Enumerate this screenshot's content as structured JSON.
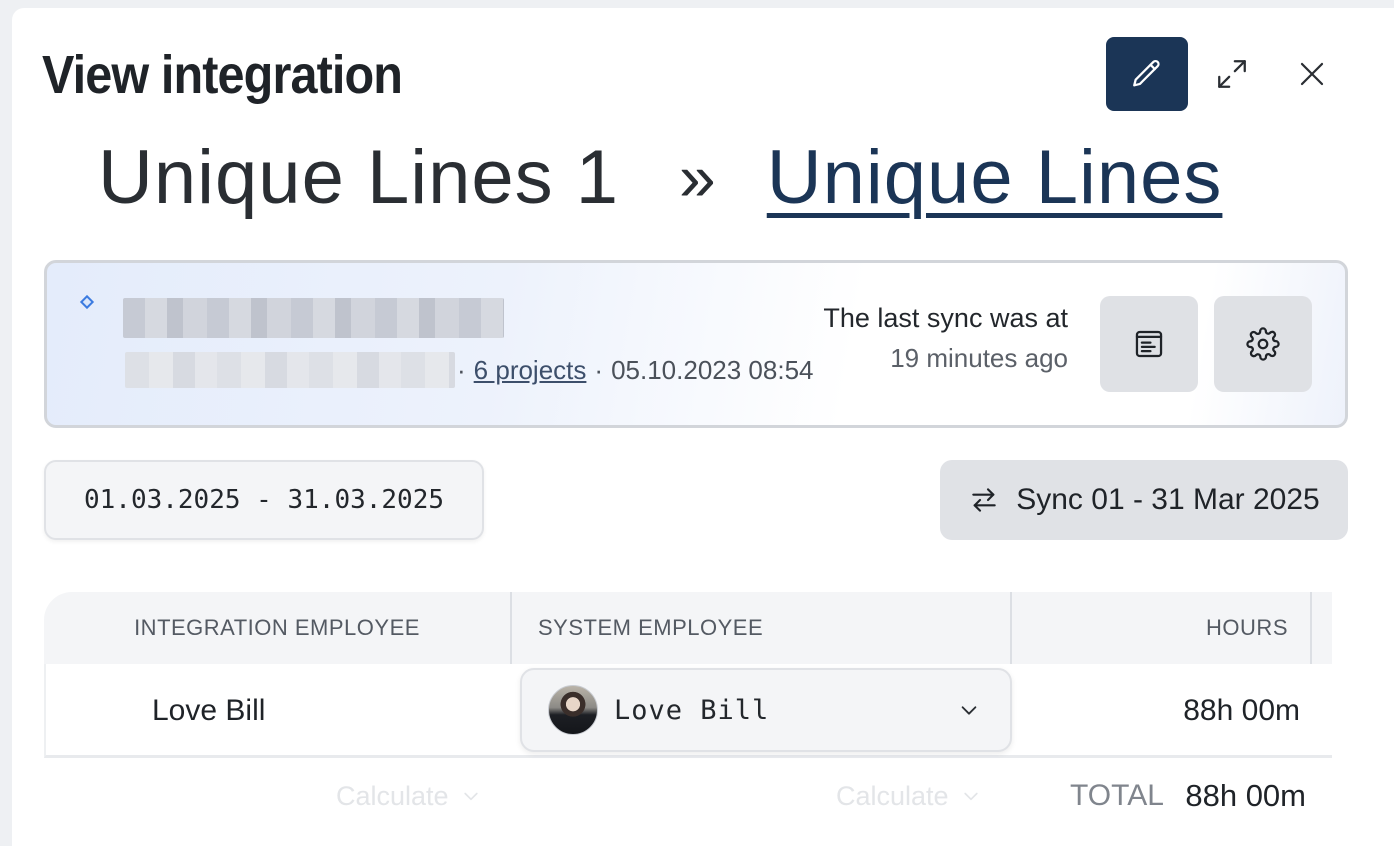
{
  "header": {
    "title": "View integration",
    "edit_icon": "pencil-icon",
    "expand_icon": "expand-icon",
    "close_icon": "close-icon",
    "accent_color": "#1b3556"
  },
  "headline": {
    "source": "Unique Lines 1",
    "separator": "»",
    "target": "Unique Lines"
  },
  "integration_card": {
    "projects_link": "6 projects",
    "bullet_1": "·",
    "bullet_2": "·",
    "created_at": "05.10.2023 08:54",
    "last_sync_label": "The last sync was at",
    "last_sync_value": "19 minutes ago",
    "log_icon": "log-icon",
    "settings_icon": "gear-icon"
  },
  "controls": {
    "date_range": "01.03.2025 - 31.03.2025",
    "sync_label": "Sync 01 - 31 Mar 2025",
    "sync_icon": "swap-arrows-icon"
  },
  "table": {
    "columns": [
      "INTEGRATION EMPLOYEE",
      "SYSTEM EMPLOYEE",
      "HOURS"
    ],
    "rows": [
      {
        "integration_employee": "Love Bill",
        "system_employee": "Love Bill",
        "hours": "88h 00m"
      }
    ],
    "footer": {
      "calculate_1": "Calculate",
      "calculate_2": "Calculate",
      "total_label": "TOTAL",
      "total_value": "88h 00m"
    }
  }
}
